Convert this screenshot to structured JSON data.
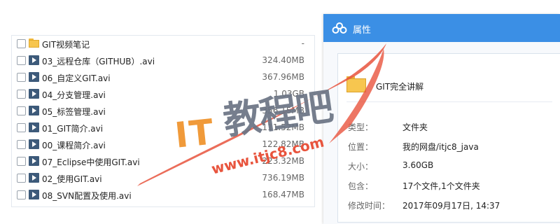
{
  "files": [
    {
      "name": "GIT视频笔记",
      "size": "-",
      "type": "folder",
      "icon": "folder-icon"
    },
    {
      "name": "03_远程仓库（GITHUB）.avi",
      "size": "324.40MB",
      "type": "video",
      "icon": "video-icon"
    },
    {
      "name": "06_自定义GIT.avi",
      "size": "367.96MB",
      "type": "video",
      "icon": "video-icon"
    },
    {
      "name": "04_分支管理.avi",
      "size": "1.03GB",
      "type": "video",
      "icon": "video-icon"
    },
    {
      "name": "05_标签管理.avi",
      "size": "356.15MB",
      "type": "video",
      "icon": "video-icon"
    },
    {
      "name": "01_GIT简介.avi",
      "size": "111.52MB",
      "type": "video",
      "icon": "video-icon"
    },
    {
      "name": "00_课程简介.avi",
      "size": "122.82MB",
      "type": "video",
      "icon": "video-icon"
    },
    {
      "name": "07_Eclipse中使用GIT.avi",
      "size": "223.32MB",
      "type": "video",
      "icon": "video-icon"
    },
    {
      "name": "02_使用GIT.avi",
      "size": "736.19MB",
      "type": "video",
      "icon": "video-icon"
    },
    {
      "name": "08_SVN配置及使用.avi",
      "size": "168.47MB",
      "type": "video",
      "icon": "video-icon"
    }
  ],
  "dialog": {
    "title": "属性",
    "title_icon": "baidu-cloud-icon",
    "folder_name": "GIT完全讲解",
    "props": [
      {
        "label": "类型：",
        "value": "文件夹"
      },
      {
        "label": "位置：",
        "value": "我的网盘/itjc8_java"
      },
      {
        "label": "大小：",
        "value": "3.60GB"
      },
      {
        "label": "包含：",
        "value": "17个文件,1个文件夹"
      },
      {
        "label": "修改时间：",
        "value": "2017年09月17日, 14:37"
      }
    ]
  },
  "watermark": {
    "brand": "IT",
    "chinese": "教程吧",
    "url": "www.itjc8.com"
  },
  "colors": {
    "titlebar": "#3b8fe5",
    "folder": "#f7c64f",
    "video_icon": "#3d5a7a",
    "watermark_orange": "#f09a3a",
    "watermark_red": "#e8543d"
  }
}
